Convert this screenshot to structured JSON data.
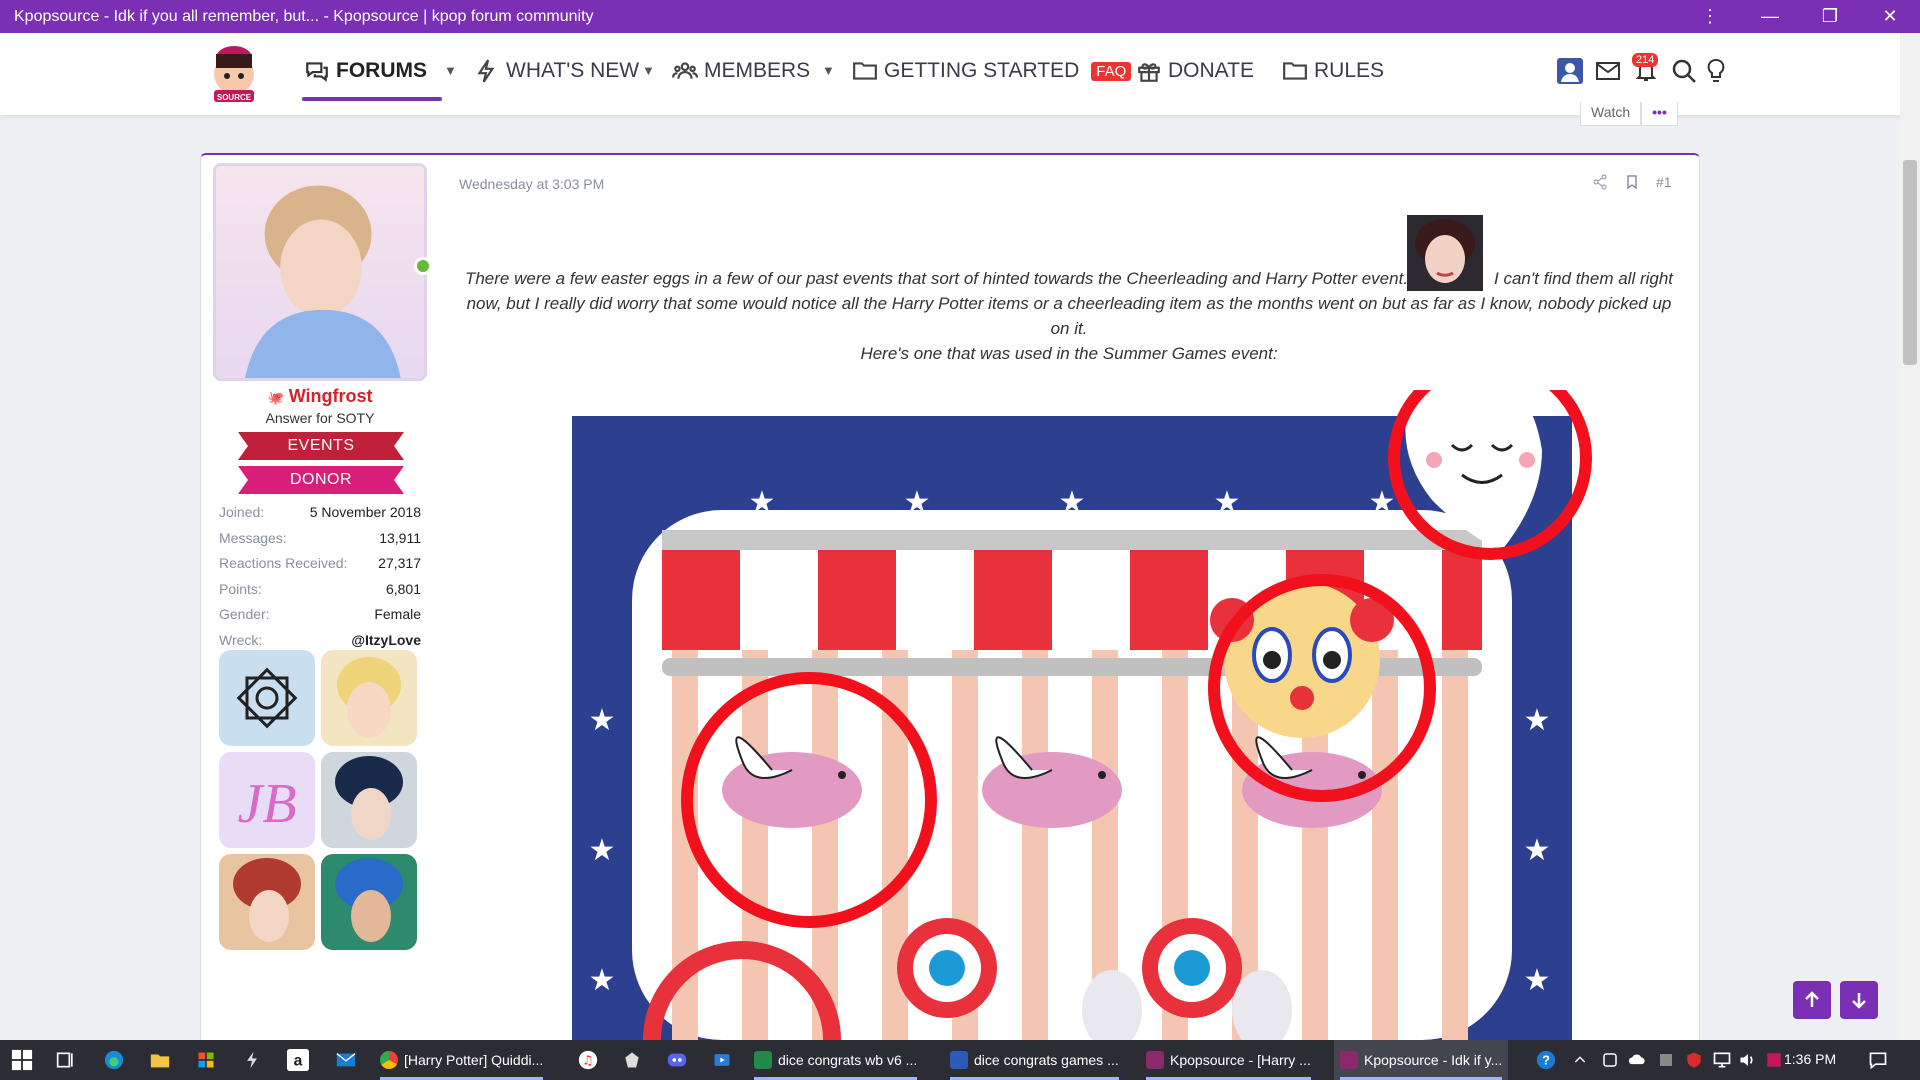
{
  "window": {
    "title": "Kpopsource - Idk if you all remember, but... - Kpopsource | kpop forum community",
    "controls": [
      "more",
      "minimize",
      "restore",
      "close"
    ]
  },
  "nav": {
    "forums": "FORUMS",
    "whats_new": "WHAT'S NEW",
    "members": "MEMBERS",
    "getting_started": "GETTING STARTED",
    "faq": "FAQ",
    "donate": "DONATE",
    "rules": "RULES",
    "notification_count": "214"
  },
  "thread_actions": {
    "watch": "Watch",
    "more": "•••"
  },
  "user": {
    "name": "Wingfrost",
    "title": "Answer for SOTY",
    "banners": [
      "EVENTS",
      "DONOR"
    ],
    "stats": [
      {
        "label": "Joined:",
        "value": "5 November 2018"
      },
      {
        "label": "Messages:",
        "value": "13,911"
      },
      {
        "label": "Reactions Received:",
        "value": "27,317"
      },
      {
        "label": "Points:",
        "value": "6,801"
      },
      {
        "label": "Gender:",
        "value": "Female"
      },
      {
        "label": "Wreck:",
        "value": "@ItzyLove"
      }
    ]
  },
  "post": {
    "date": "Wednesday at 3:03 PM",
    "number": "#1",
    "text_line1a": "There were a few easter eggs in a few of our past events that sort of hinted towards the Cheerleading and Harry Potter event.",
    "text_line1b": "I can't find them all right now, but I really did worry that some would notice all the Harry Potter items or a cheerleading item as the months went on but as far as I know, nobody picked up on it.",
    "text_line2": "Here's one that was used in the Summer Games event:"
  },
  "taskbar": {
    "apps": [
      {
        "label": "[Harry Potter] Quiddi...",
        "color": "#e94235"
      },
      {
        "label": "dice congrats wb v6 ...",
        "color": "#1f8a4c"
      },
      {
        "label": "dice congrats games ...",
        "color": "#2b5cb8"
      },
      {
        "label": "Kpopsource - [Harry ...",
        "color": "#8a2a6a"
      },
      {
        "label": "Kpopsource - Idk if y...",
        "color": "#8a2a6a"
      }
    ],
    "time": "1:36 PM"
  },
  "colors": {
    "accent": "#7a2fb4",
    "username": "#d6212c",
    "events_banner": "#c0203a",
    "donor_banner": "#d81e78"
  }
}
